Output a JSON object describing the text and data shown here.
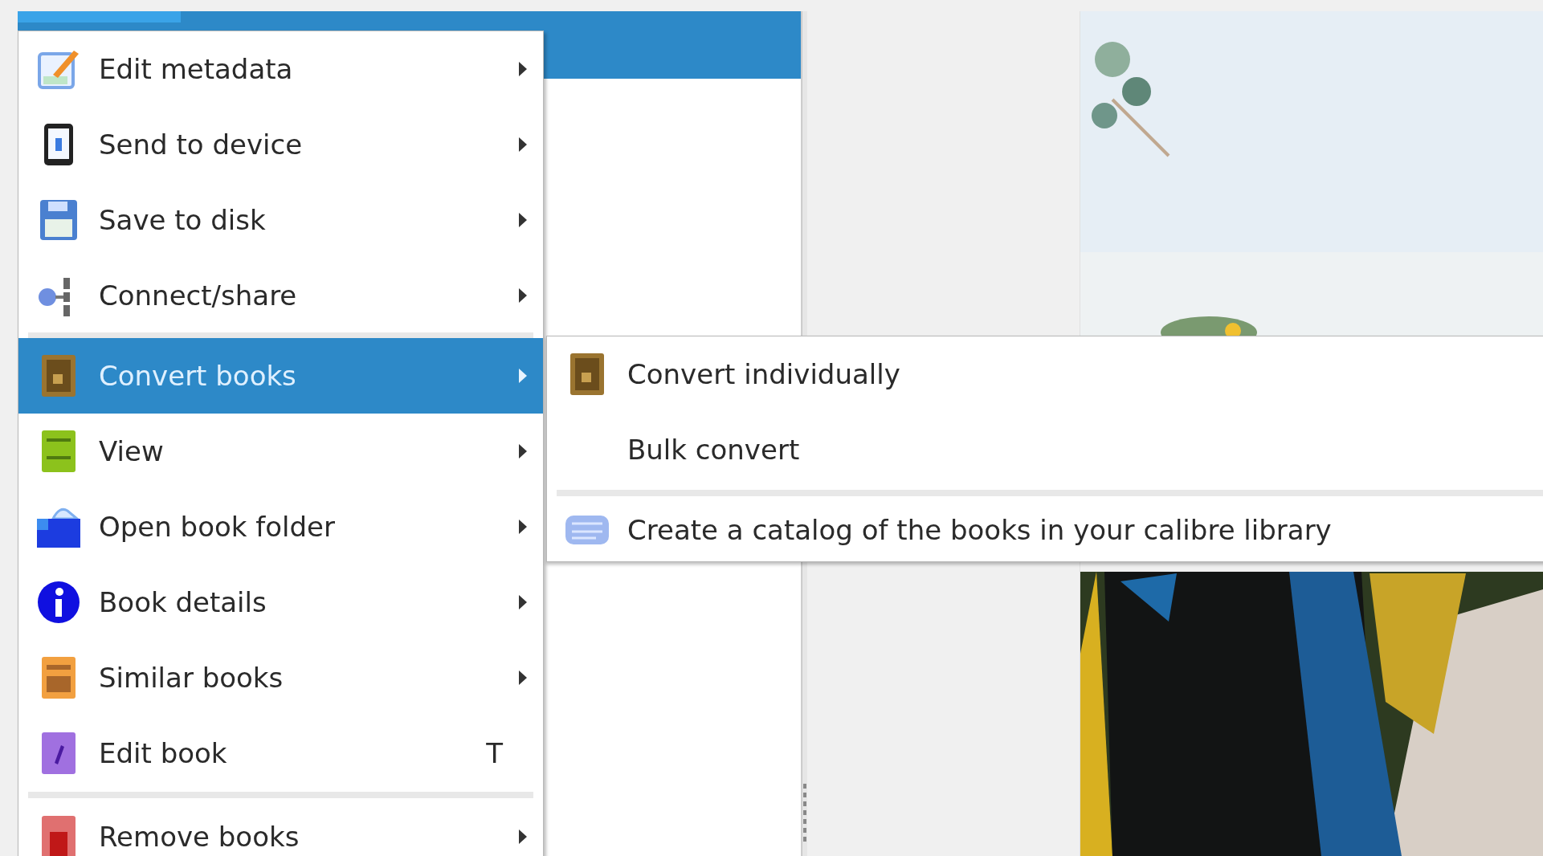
{
  "book_list": {
    "rows": [
      {
        "selected": true
      }
    ]
  },
  "menu": {
    "items": [
      {
        "kind": "item",
        "label": "Edit metadata",
        "submenu": true,
        "selected": false
      },
      {
        "kind": "item",
        "label": "Send to device",
        "submenu": true,
        "selected": false
      },
      {
        "kind": "item",
        "label": "Save to disk",
        "submenu": true,
        "selected": false
      },
      {
        "kind": "item",
        "label": "Connect/share",
        "submenu": true,
        "selected": false
      },
      {
        "kind": "separator"
      },
      {
        "kind": "item",
        "label": "Convert books",
        "submenu": true,
        "selected": true
      },
      {
        "kind": "item",
        "label": "View",
        "submenu": true,
        "selected": false
      },
      {
        "kind": "item",
        "label": "Open book folder",
        "submenu": true,
        "selected": false
      },
      {
        "kind": "item",
        "label": "Book details",
        "submenu": true,
        "selected": false
      },
      {
        "kind": "item",
        "label": "Similar books",
        "submenu": true,
        "selected": false
      },
      {
        "kind": "item",
        "label": "Edit book",
        "shortcut": "T",
        "submenu": false,
        "selected": false
      },
      {
        "kind": "separator"
      },
      {
        "kind": "item",
        "label": "Remove books",
        "submenu": true,
        "selected": false
      }
    ]
  },
  "submenu": {
    "items": [
      {
        "kind": "item",
        "label": "Convert individually",
        "selected": false
      },
      {
        "kind": "item",
        "label": "Bulk convert",
        "selected": false
      },
      {
        "kind": "separator"
      },
      {
        "kind": "item",
        "label": "Create a catalog of the books in your calibre library",
        "selected": false
      }
    ]
  }
}
